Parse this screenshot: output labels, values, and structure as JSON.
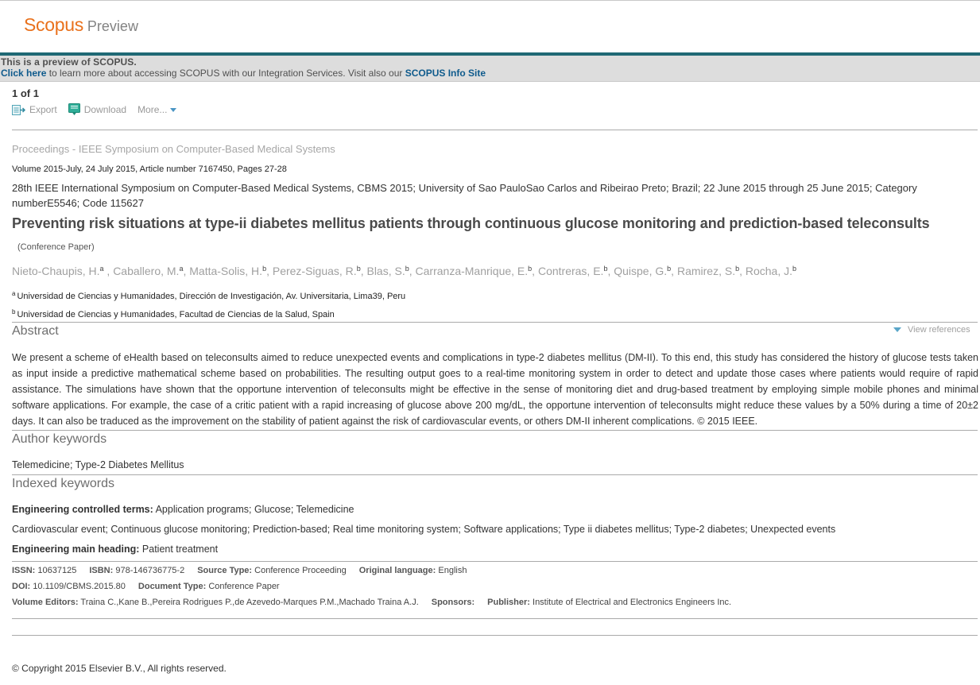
{
  "logo": {
    "main": "Scopus",
    "sub": "Preview"
  },
  "preview": {
    "line1": "This is a preview of SCOPUS.",
    "click_here": "Click here",
    "middle": " to learn more about accessing SCOPUS with our Integration Services. Visit also our ",
    "info_site": "SCOPUS Info Site"
  },
  "counter": {
    "current": "1",
    "sep": " of ",
    "total": "1"
  },
  "toolbar": {
    "export": "Export",
    "download": "Download",
    "more": "More..."
  },
  "source": {
    "title": "Proceedings - IEEE Symposium on Computer-Based Medical Systems",
    "volume": "Volume 2015-July, 24 July 2015, Article number 7167450, Pages 27-28",
    "conference": "28th IEEE International Symposium on Computer-Based Medical Systems, CBMS 2015; University of Sao PauloSao Carlos and Ribeirao Preto; Brazil; 22 June 2015 through 25 June 2015; Category numberE5546; Code 115627"
  },
  "document": {
    "title": "Preventing risk situations at type-ii diabetes mellitus patients through continuous glucose monitoring and prediction-based teleconsults",
    "type": "(Conference Paper)"
  },
  "authors": [
    {
      "name": "Nieto-Chaupis, H.",
      "sup": "a",
      "sep": " , "
    },
    {
      "name": "Caballero, M.",
      "sup": "a",
      "sep": ", "
    },
    {
      "name": "Matta-Solis, H.",
      "sup": "b",
      "sep": ", "
    },
    {
      "name": "Perez-Siguas, R.",
      "sup": "b",
      "sep": ", "
    },
    {
      "name": "Blas, S.",
      "sup": "b",
      "sep": ", "
    },
    {
      "name": "Carranza-Manrique, E.",
      "sup": "b",
      "sep": ", "
    },
    {
      "name": "Contreras, E.",
      "sup": "b",
      "sep": ", "
    },
    {
      "name": "Quispe, G.",
      "sup": "b",
      "sep": ", "
    },
    {
      "name": "Ramirez, S.",
      "sup": "b",
      "sep": ", "
    },
    {
      "name": "Rocha, J.",
      "sup": "b",
      "sep": ""
    }
  ],
  "affiliations": [
    {
      "sup": "a",
      "text": "Universidad de Ciencias y Humanidades, Dirección de Investigación, Av. Universitaria, Lima39, Peru"
    },
    {
      "sup": "b",
      "text": "Universidad de Ciencias y Humanidades, Facultad de Ciencias de la Salud, Spain"
    }
  ],
  "abstract": {
    "heading": "Abstract",
    "view_references": "View references",
    "text": "We present a scheme of eHealth based on teleconsults aimed to reduce unexpected events and complications in type-2 diabetes mellitus (DM-II). To this end, this study has considered the history of glucose tests taken as input inside a predictive mathematical scheme based on probabilities. The resulting output goes to a real-time monitoring system in order to detect and update those cases where patients would require of rapid assistance. The simulations have shown that the opportune intervention of teleconsults might be effective in the sense of monitoring diet and drug-based treatment by employing simple mobile phones and minimal software applications. For example, the case of a critic patient with a rapid increasing of glucose above 200 mg/dL, the opportune intervention of teleconsults might reduce these values by a 50% during a time of 20±2 days. It can also be traduced as the improvement on the stability of patient against the risk of cardiovascular events, or others DM-II inherent complications. © 2015 IEEE."
  },
  "author_keywords": {
    "heading": "Author keywords",
    "text": "Telemedicine; Type-2 Diabetes Mellitus"
  },
  "indexed_keywords": {
    "heading": "Indexed keywords",
    "controlled_label": "Engineering controlled terms:",
    "controlled_value": " Application programs; Glucose; Telemedicine",
    "uncontrolled": "Cardiovascular event; Continuous glucose monitoring; Prediction-based; Real time monitoring system; Software applications; Type ii diabetes mellitus; Type-2 diabetes; Unexpected events",
    "main_label": "Engineering main heading:",
    "main_value": " Patient treatment"
  },
  "meta": {
    "issn_label": "ISSN:",
    "issn": " 10637125",
    "isbn_label": "ISBN:",
    "isbn": " 978-146736775-2",
    "source_type_label": "Source Type:",
    "source_type": " Conference Proceeding",
    "language_label": "Original language:",
    "language": " English",
    "doi_label": "DOI:",
    "doi": " 10.1109/CBMS.2015.80",
    "doc_type_label": "Document Type:",
    "doc_type": " Conference Paper",
    "editors_label": "Volume Editors:",
    "editors": " Traina C.,Kane B.,Pereira Rodrigues P.,de Azevedo-Marques P.M.,Machado Traina A.J.",
    "sponsors_label": "Sponsors:",
    "publisher_label": "Publisher:",
    "publisher": " Institute of Electrical and Electronics Engineers Inc."
  },
  "footer": {
    "copyright": "© Copyright 2015 Elsevier B.V., All rights reserved."
  }
}
